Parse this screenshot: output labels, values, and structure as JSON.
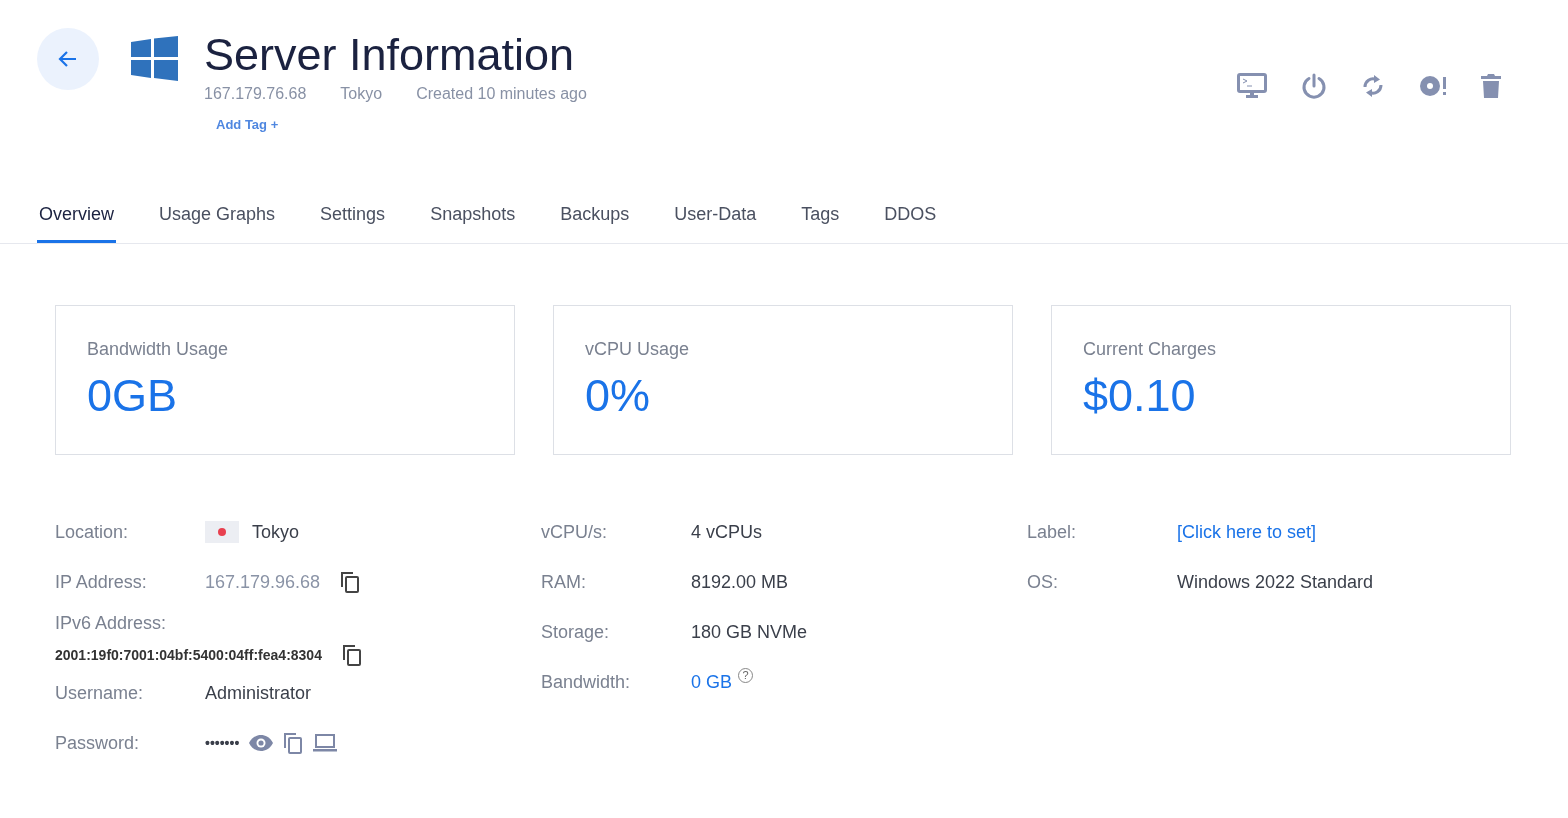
{
  "header": {
    "title": "Server Information",
    "meta": [
      "167.179.76.68",
      "Tokyo",
      "Created 10 minutes ago"
    ],
    "add_tag": "Add Tag +"
  },
  "tabs": [
    {
      "label": "Overview",
      "selected": true
    },
    {
      "label": "Usage Graphs",
      "selected": false
    },
    {
      "label": "Settings",
      "selected": false
    },
    {
      "label": "Snapshots",
      "selected": false
    },
    {
      "label": "Backups",
      "selected": false
    },
    {
      "label": "User-Data",
      "selected": false
    },
    {
      "label": "Tags",
      "selected": false
    },
    {
      "label": "DDOS",
      "selected": false
    }
  ],
  "cards": [
    {
      "title": "Bandwidth Usage",
      "value": "0GB"
    },
    {
      "title": "vCPU Usage",
      "value": "0%"
    },
    {
      "title": "Current Charges",
      "value": "$0.10"
    }
  ],
  "details": [
    [
      {
        "kind": "location",
        "label": "Location:",
        "value": "Tokyo"
      },
      {
        "kind": "ip",
        "label": "IP Address:",
        "value": "167.179.96.68"
      },
      {
        "kind": "ipv6",
        "label": "IPv6 Address:",
        "value": "2001:19f0:7001:04bf:5400:04ff:fea4:8304"
      },
      {
        "kind": "text",
        "label": "Username:",
        "value": "Administrator"
      },
      {
        "kind": "password",
        "label": "Password:",
        "value": "•••••••"
      }
    ],
    [
      {
        "kind": "text",
        "label": "vCPU/s:",
        "value": "4 vCPUs"
      },
      {
        "kind": "text",
        "label": "RAM:",
        "value": "8192.00 MB"
      },
      {
        "kind": "text",
        "label": "Storage:",
        "value": "180 GB NVMe"
      },
      {
        "kind": "help-link",
        "label": "Bandwidth:",
        "value": "0 GB",
        "help": "?"
      }
    ],
    [
      {
        "kind": "link",
        "label": "Label:",
        "value": "[Click here to set]"
      },
      {
        "kind": "text",
        "label": "OS:",
        "value": "Windows 2022 Standard"
      }
    ]
  ]
}
